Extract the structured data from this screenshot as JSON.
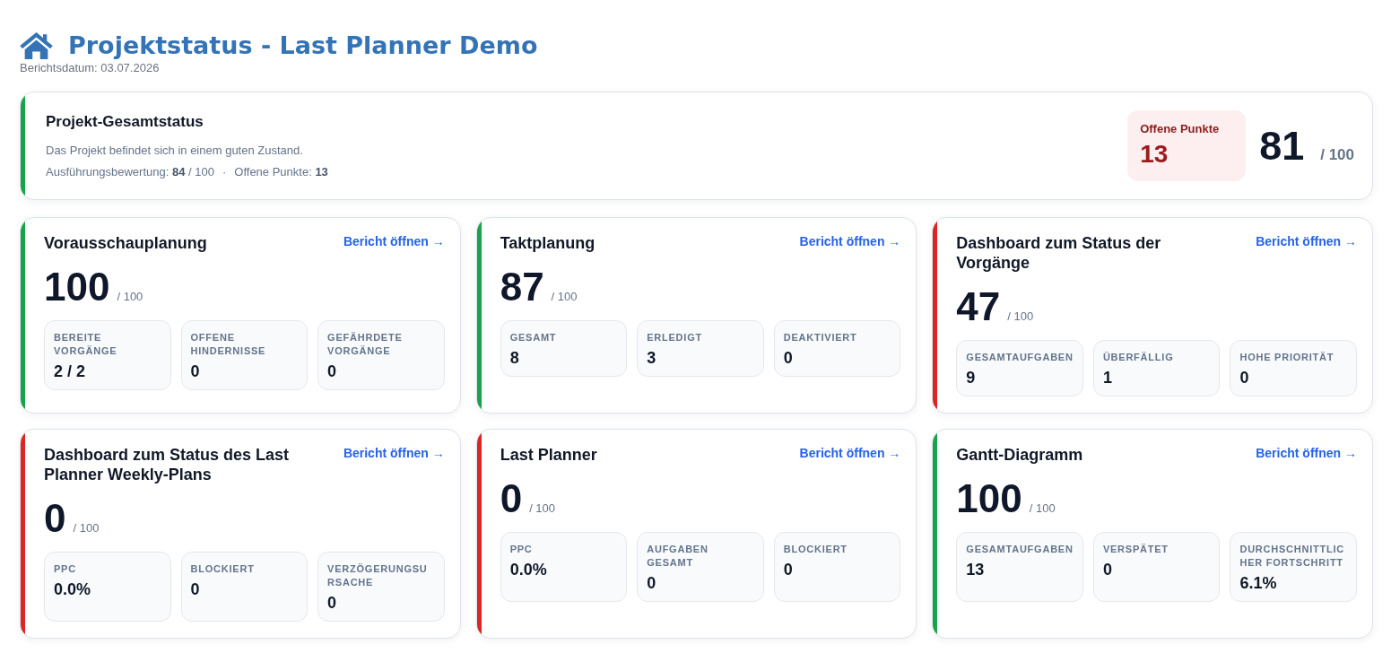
{
  "header": {
    "title": "Projektstatus - Last Planner Demo",
    "report_date": "Berichtsdatum: 03.07.2026"
  },
  "summary": {
    "title": "Projekt-Gesamtstatus",
    "color": "#16a34a",
    "description": "Das Projekt befindet sich in einem guten Zustand.",
    "stats": [
      "Ausführungsbewertung: **84** / 100",
      "Offene Punkte: **13**"
    ],
    "separator": "·",
    "open_points": {
      "label": "Offene Punkte",
      "value": "13"
    },
    "score": {
      "value": "81",
      "max": "/ 100"
    }
  },
  "cards": [
    {
      "title": "Vorausschauplanung",
      "color": "#16a34a",
      "link": "Bericht öffnen →",
      "score": "100",
      "max": "/ 100",
      "metrics": [
        {
          "label": "BEREITE VORGÄNGE",
          "value": "2 / 2"
        },
        {
          "label": "OFFENE HINDERNISSE",
          "value": "0"
        },
        {
          "label": "GEFÄHRDETE VORGÄNGE",
          "value": "0"
        }
      ]
    },
    {
      "title": "Taktplanung",
      "color": "#16a34a",
      "link": "Bericht öffnen →",
      "score": "87",
      "max": "/ 100",
      "metrics": [
        {
          "label": "GESAMT",
          "value": "8"
        },
        {
          "label": "ERLEDIGT",
          "value": "3"
        },
        {
          "label": "DEAKTIVIERT",
          "value": "0"
        }
      ]
    },
    {
      "title": "Dashboard zum Status der Vorgänge",
      "color": "#dc2626",
      "link": "Bericht öffnen →",
      "score": "47",
      "max": "/ 100",
      "metrics": [
        {
          "label": "GESAMTAUFGABEN",
          "value": "9"
        },
        {
          "label": "ÜBERFÄLLIG",
          "value": "1"
        },
        {
          "label": "HOHE PRIORITÄT",
          "value": "0"
        }
      ]
    },
    {
      "title": "Dashboard zum Status des Last Planner Weekly-Plans",
      "color": "#dc2626",
      "link": "Bericht öffnen →",
      "score": "0",
      "max": "/ 100",
      "metrics": [
        {
          "label": "PPC",
          "value": "0.0%"
        },
        {
          "label": "BLOCKIERT",
          "value": "0"
        },
        {
          "label": "VERZÖGERUNGSURSACHE",
          "value": "0"
        }
      ]
    },
    {
      "title": "Last Planner",
      "color": "#dc2626",
      "link": "Bericht öffnen →",
      "score": "0",
      "max": "/ 100",
      "metrics": [
        {
          "label": "PPC",
          "value": "0.0%"
        },
        {
          "label": "AUFGABEN GESAMT",
          "value": "0"
        },
        {
          "label": "BLOCKIERT",
          "value": "0"
        }
      ]
    },
    {
      "title": "Gantt-Diagramm",
      "color": "#16a34a",
      "link": "Bericht öffnen →",
      "score": "100",
      "max": "/ 100",
      "metrics": [
        {
          "label": "GESAMTAUFGABEN",
          "value": "13"
        },
        {
          "label": "VERSPÄTET",
          "value": "0"
        },
        {
          "label": "DURCHSCHNITTLICHER FORTSCHRITT",
          "value": "6.1%"
        }
      ]
    }
  ]
}
